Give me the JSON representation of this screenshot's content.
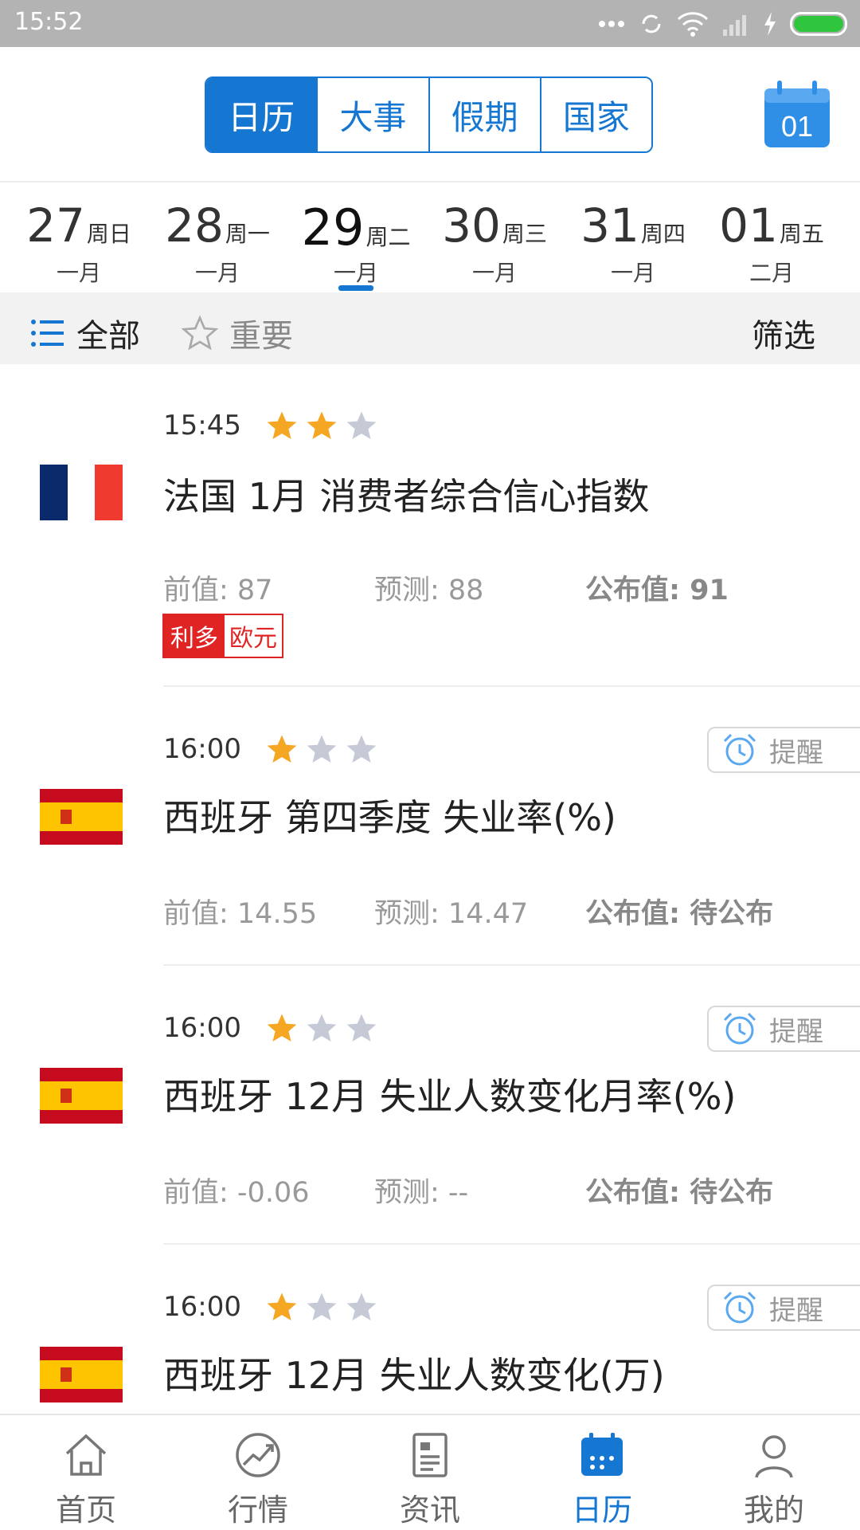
{
  "status_bar": {
    "time": "15:52"
  },
  "header": {
    "tabs": [
      {
        "label": "日历",
        "active": true
      },
      {
        "label": "大事",
        "active": false
      },
      {
        "label": "假期",
        "active": false
      },
      {
        "label": "国家",
        "active": false
      }
    ],
    "calendar_day": "01",
    "accent_color": "#1677d2"
  },
  "dates": [
    {
      "day": "27",
      "weekday": "周日",
      "month": "一月",
      "selected": false
    },
    {
      "day": "28",
      "weekday": "周一",
      "month": "一月",
      "selected": false
    },
    {
      "day": "29",
      "weekday": "周二",
      "month": "一月",
      "selected": true
    },
    {
      "day": "30",
      "weekday": "周三",
      "month": "一月",
      "selected": false
    },
    {
      "day": "31",
      "weekday": "周四",
      "month": "一月",
      "selected": false
    },
    {
      "day": "01",
      "weekday": "周五",
      "month": "二月",
      "selected": false
    }
  ],
  "filter": {
    "all_label": "全部",
    "important_label": "重要",
    "filter_label": "筛选"
  },
  "events": [
    {
      "time": "15:45",
      "stars": 2,
      "country": "france",
      "title": "法国 1月 消费者综合信心指数",
      "prev": "前值: 87",
      "forecast": "预测: 88",
      "actual": "公布值: 91",
      "badge": {
        "left": "利多",
        "right": "欧元"
      },
      "remind": null
    },
    {
      "time": "16:00",
      "stars": 1,
      "country": "spain",
      "title": "西班牙 第四季度 失业率(%)",
      "prev": "前值: 14.55",
      "forecast": "预测: 14.47",
      "actual": "公布值: 待公布",
      "badge": null,
      "remind": "提醒"
    },
    {
      "time": "16:00",
      "stars": 1,
      "country": "spain",
      "title": "西班牙 12月 失业人数变化月率(%)",
      "prev": "前值: -0.06",
      "forecast": "预测: --",
      "actual": "公布值: 待公布",
      "badge": null,
      "remind": "提醒"
    },
    {
      "time": "16:00",
      "stars": 1,
      "country": "spain",
      "title": "西班牙 12月 失业人数变化(万)",
      "prev": "",
      "forecast": "",
      "actual": "",
      "badge": null,
      "remind": "提醒"
    }
  ],
  "bottom_nav": [
    {
      "label": "首页",
      "icon": "home-icon",
      "active": false
    },
    {
      "label": "行情",
      "icon": "market-chart-icon",
      "active": false
    },
    {
      "label": "资讯",
      "icon": "news-icon",
      "active": false
    },
    {
      "label": "日历",
      "icon": "calendar-icon",
      "active": true
    },
    {
      "label": "我的",
      "icon": "profile-icon",
      "active": false
    }
  ]
}
